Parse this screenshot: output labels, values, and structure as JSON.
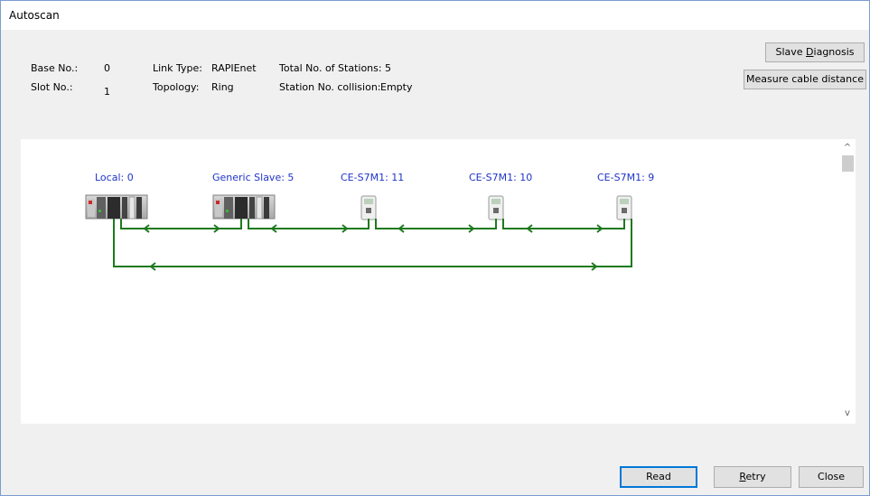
{
  "window": {
    "title": "Autoscan"
  },
  "info": {
    "base_label": "Base No.:",
    "base_value": "0",
    "slot_label": "Slot No.:",
    "slot_value": "1",
    "link_type_label": "Link Type:",
    "link_type_value": "RAPIEnet",
    "topology_label": "Topology:",
    "topology_value": "Ring",
    "total_label": "Total No. of Stations:",
    "total_value": "5",
    "collision_label": "Station No. collision:",
    "collision_value": "Empty"
  },
  "buttons": {
    "slave_diag_pre": "Slave ",
    "slave_diag_u": "D",
    "slave_diag_post": "iagnosis",
    "measure": "Measure cable distance",
    "read": "Read",
    "retry_u": "R",
    "retry_post": "etry",
    "close": "Close"
  },
  "nodes": [
    {
      "label": "Local: 0",
      "kind": "plc"
    },
    {
      "label": "Generic Slave: 5",
      "kind": "plc"
    },
    {
      "label": "CE-S7M1: 11",
      "kind": "drive"
    },
    {
      "label": "CE-S7M1: 10",
      "kind": "drive"
    },
    {
      "label": "CE-S7M1: 9",
      "kind": "drive"
    }
  ],
  "scroll": {
    "up_icon": "^",
    "down_icon": "v"
  },
  "colors": {
    "link": "#1e7a1e",
    "label": "#1e34c8",
    "default_border": "#0078d7"
  }
}
